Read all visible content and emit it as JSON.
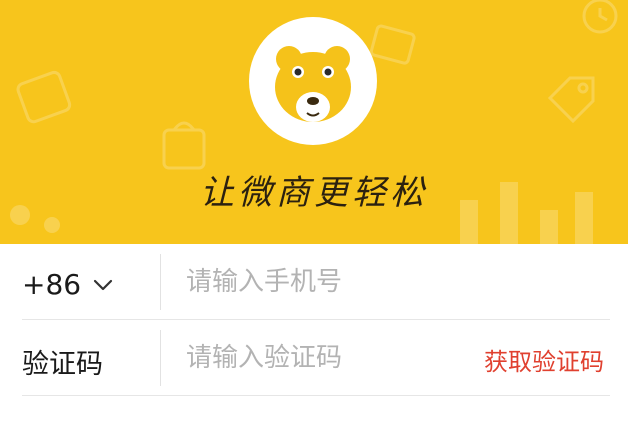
{
  "header": {
    "slogan": "让微商更轻松",
    "background_color": "#f7c51c",
    "logo": "bear-face-logo"
  },
  "phone_row": {
    "country_code": "+86",
    "dropdown_icon": "chevron-down-icon",
    "placeholder": "请输入手机号",
    "value": ""
  },
  "code_row": {
    "label": "验证码",
    "placeholder": "请输入验证码",
    "value": "",
    "get_code_label": "获取验证码",
    "get_code_color": "#e0402f"
  }
}
